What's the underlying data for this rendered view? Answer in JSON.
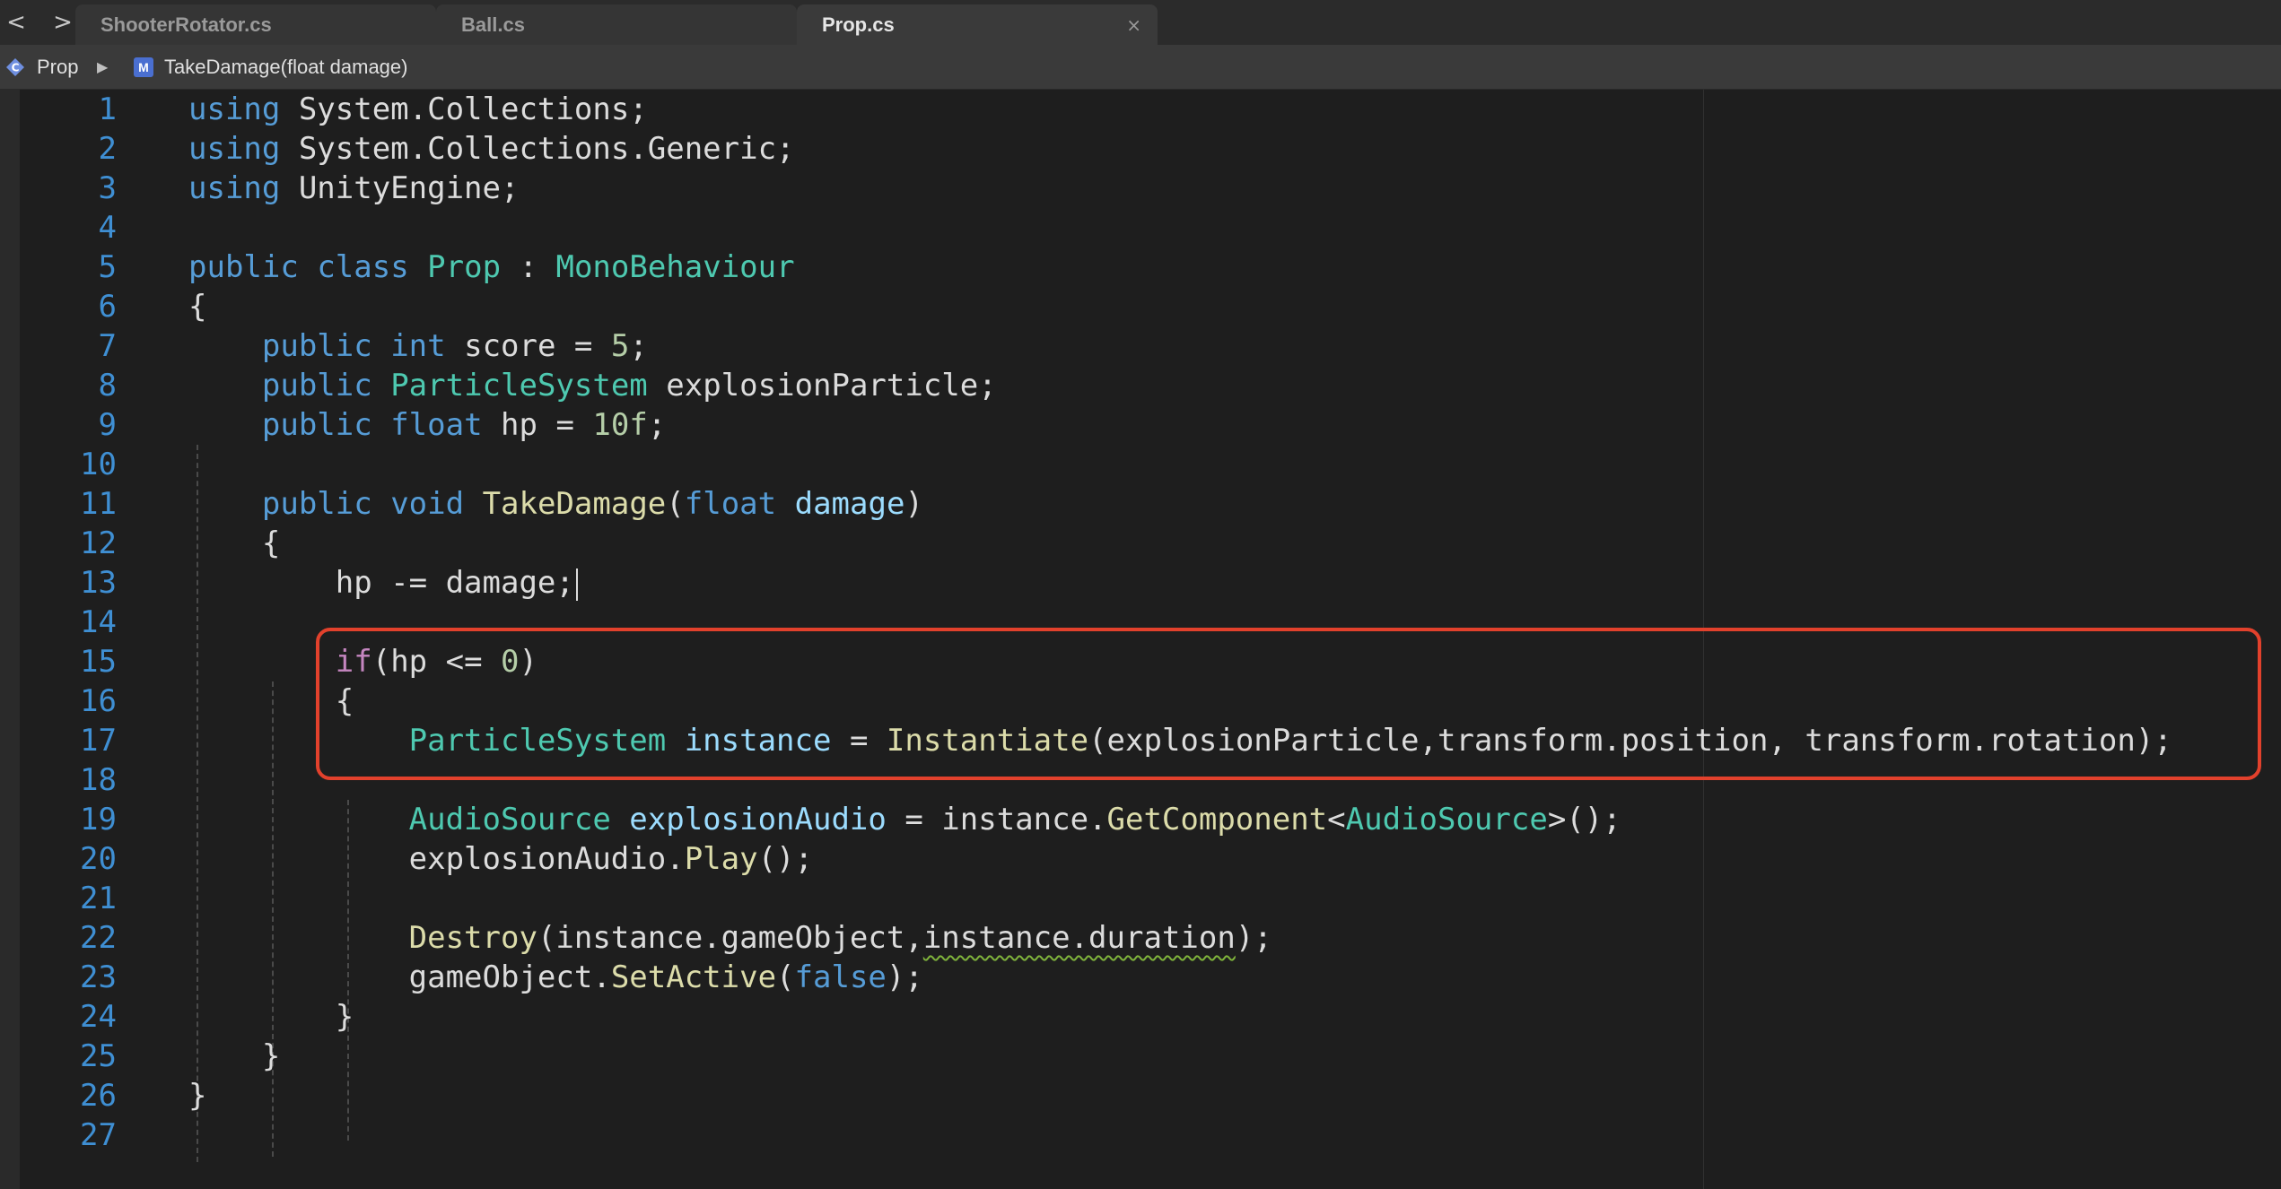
{
  "tabs": [
    {
      "label": "ShooterRotator.cs",
      "active": false
    },
    {
      "label": "Ball.cs",
      "active": false
    },
    {
      "label": "Prop.cs",
      "active": true,
      "close_glyph": "×"
    }
  ],
  "nav": {
    "back_glyph": "<",
    "forward_glyph": ">"
  },
  "breadcrumb": {
    "class_label": "Prop",
    "separator": "▶",
    "method_icon_letter": "M",
    "method_label": "TakeDamage(float damage)"
  },
  "line_numbers": [
    "1",
    "2",
    "3",
    "4",
    "5",
    "6",
    "7",
    "8",
    "9",
    "10",
    "11",
    "12",
    "13",
    "14",
    "15",
    "16",
    "17",
    "18",
    "19",
    "20",
    "21",
    "22",
    "23",
    "24",
    "25",
    "26",
    "27"
  ],
  "code_lines": [
    [
      {
        "t": "using",
        "c": "kw"
      },
      {
        "t": " System.Collections;"
      }
    ],
    [
      {
        "t": "using",
        "c": "kw"
      },
      {
        "t": " System.Collections.Generic;"
      }
    ],
    [
      {
        "t": "using",
        "c": "kw"
      },
      {
        "t": " UnityEngine;"
      }
    ],
    [],
    [
      {
        "t": "public",
        "c": "kw"
      },
      {
        "t": " "
      },
      {
        "t": "class",
        "c": "kw"
      },
      {
        "t": " "
      },
      {
        "t": "Prop",
        "c": "type"
      },
      {
        "t": " : "
      },
      {
        "t": "MonoBehaviour",
        "c": "type"
      }
    ],
    [
      {
        "t": "{"
      }
    ],
    [
      {
        "t": "    "
      },
      {
        "t": "public",
        "c": "kw"
      },
      {
        "t": " "
      },
      {
        "t": "int",
        "c": "kw"
      },
      {
        "t": " score = "
      },
      {
        "t": "5",
        "c": "num"
      },
      {
        "t": ";"
      }
    ],
    [
      {
        "t": "    "
      },
      {
        "t": "public",
        "c": "kw"
      },
      {
        "t": " "
      },
      {
        "t": "ParticleSystem",
        "c": "type"
      },
      {
        "t": " explosionParticle;"
      }
    ],
    [
      {
        "t": "    "
      },
      {
        "t": "public",
        "c": "kw"
      },
      {
        "t": " "
      },
      {
        "t": "float",
        "c": "kw"
      },
      {
        "t": " hp = "
      },
      {
        "t": "10f",
        "c": "num"
      },
      {
        "t": ";"
      }
    ],
    [],
    [
      {
        "t": "    "
      },
      {
        "t": "public",
        "c": "kw"
      },
      {
        "t": " "
      },
      {
        "t": "void",
        "c": "kw"
      },
      {
        "t": " "
      },
      {
        "t": "TakeDamage",
        "c": "fn"
      },
      {
        "t": "("
      },
      {
        "t": "float",
        "c": "kw"
      },
      {
        "t": " "
      },
      {
        "t": "damage",
        "c": "var"
      },
      {
        "t": ")"
      }
    ],
    [
      {
        "t": "    {"
      }
    ],
    [
      {
        "t": "        hp -= damage;"
      },
      {
        "caret": true
      }
    ],
    [],
    [
      {
        "t": "        "
      },
      {
        "t": "if",
        "c": "ctl"
      },
      {
        "t": "(hp <= "
      },
      {
        "t": "0",
        "c": "num"
      },
      {
        "t": ")"
      }
    ],
    [
      {
        "t": "        {"
      }
    ],
    [
      {
        "t": "            "
      },
      {
        "t": "ParticleSystem",
        "c": "type"
      },
      {
        "t": " "
      },
      {
        "t": "instance",
        "c": "var"
      },
      {
        "t": " = "
      },
      {
        "t": "Instantiate",
        "c": "fn"
      },
      {
        "t": "(explosionParticle,transform.position, transform.rotation);"
      }
    ],
    [],
    [
      {
        "t": "            "
      },
      {
        "t": "AudioSource",
        "c": "type"
      },
      {
        "t": " "
      },
      {
        "t": "explosionAudio",
        "c": "var"
      },
      {
        "t": " = instance."
      },
      {
        "t": "GetComponent",
        "c": "fn"
      },
      {
        "t": "<"
      },
      {
        "t": "AudioSource",
        "c": "type"
      },
      {
        "t": ">();"
      }
    ],
    [
      {
        "t": "            explosionAudio."
      },
      {
        "t": "Play",
        "c": "fn"
      },
      {
        "t": "();"
      }
    ],
    [],
    [
      {
        "t": "            "
      },
      {
        "t": "Destroy",
        "c": "fn"
      },
      {
        "t": "(instance.gameObject,"
      },
      {
        "t": "instance.duration",
        "c": "squig"
      },
      {
        "t": ");"
      }
    ],
    [
      {
        "t": "            gameObject."
      },
      {
        "t": "SetActive",
        "c": "fn"
      },
      {
        "t": "("
      },
      {
        "t": "false",
        "c": "kw"
      },
      {
        "t": ");"
      }
    ],
    [
      {
        "t": "        }"
      }
    ],
    [
      {
        "t": "    }"
      }
    ],
    [
      {
        "t": "}"
      }
    ],
    []
  ],
  "colors": {
    "keyword": "#569cd6",
    "type": "#4ec9b0",
    "control": "#c586c0",
    "number": "#b5cea8",
    "function": "#dcdcaa",
    "variable": "#9cdcfe",
    "highlight_border": "#e2412c",
    "line_number": "#3f8fd3"
  }
}
